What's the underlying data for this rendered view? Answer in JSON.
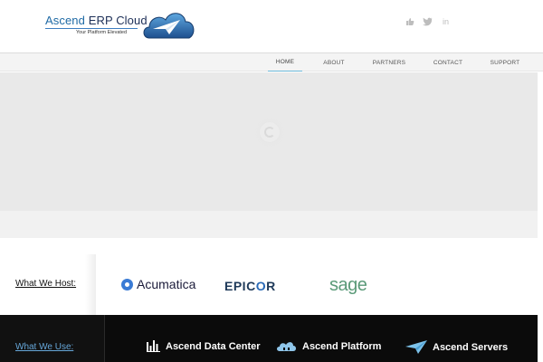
{
  "header": {
    "logo": {
      "title_part1": "Ascend",
      "title_part2": "ERP Cloud",
      "subtitle": "Your Platform Elevated"
    },
    "social": [
      {
        "name": "thumbs-up-icon"
      },
      {
        "name": "twitter-icon"
      },
      {
        "name": "linkedin-icon",
        "glyph": "in"
      }
    ]
  },
  "nav": {
    "items": [
      {
        "label": "HOME",
        "active": true
      },
      {
        "label": "ABOUT",
        "active": false
      },
      {
        "label": "PARTNERS",
        "active": false
      },
      {
        "label": "CONTACT",
        "active": false
      },
      {
        "label": "SUPPORT",
        "active": false
      }
    ]
  },
  "host": {
    "label": "What We Host:",
    "brands": [
      {
        "name": "Acumatica"
      },
      {
        "name": "EPICOR",
        "part1": "EPIC",
        "part2": "O",
        "part3": "R"
      },
      {
        "name": "sage"
      }
    ]
  },
  "use": {
    "label": "What We Use:",
    "items": [
      {
        "label": "Ascend Data Center",
        "icon": "bar-chart-icon"
      },
      {
        "label": "Ascend Platform",
        "icon": "cloud-icon"
      },
      {
        "label": "Ascend Servers",
        "icon": "paper-plane-icon"
      }
    ]
  },
  "colors": {
    "accent": "#6bb7d8",
    "brand_blue": "#1f6aa5",
    "link_blue": "#66a7d9",
    "dark_band": "#0b0b0b"
  }
}
